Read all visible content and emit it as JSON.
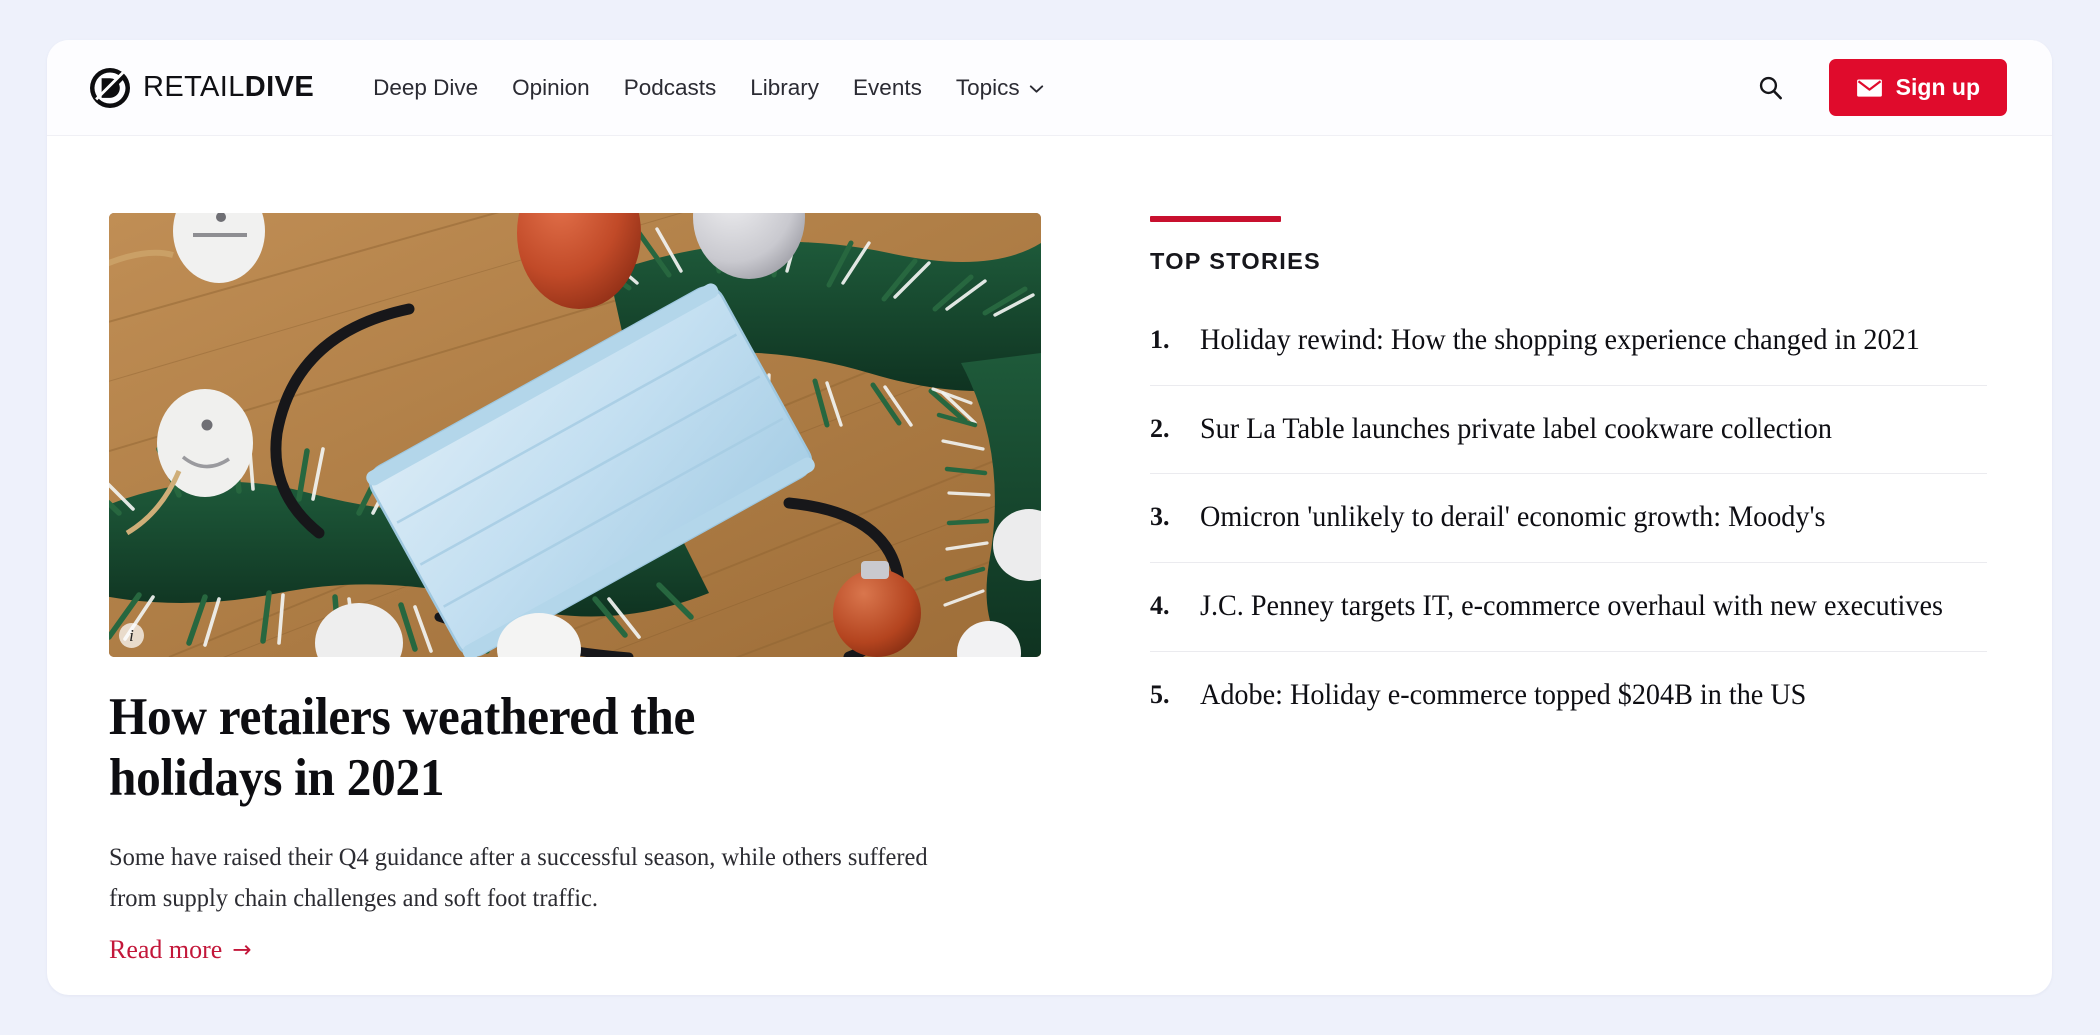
{
  "theme": {
    "page_background": "#eef1fb",
    "card_background": "#ffffff",
    "brand_red": "#e00b2c",
    "accent_red": "#c8102e",
    "link_red": "#c3173a",
    "text_dark": "#0e0e13"
  },
  "header": {
    "brand_mark_icon": "retail-dive-logo-icon",
    "brand_name_light": "RETAIL",
    "brand_name_bold": "DIVE",
    "nav": [
      {
        "label": "Deep Dive",
        "has_dropdown": false
      },
      {
        "label": "Opinion",
        "has_dropdown": false
      },
      {
        "label": "Podcasts",
        "has_dropdown": false
      },
      {
        "label": "Library",
        "has_dropdown": false
      },
      {
        "label": "Events",
        "has_dropdown": false
      },
      {
        "label": "Topics",
        "has_dropdown": true
      }
    ],
    "search_icon": "search-icon",
    "signup": {
      "label": "Sign up",
      "icon": "envelope-icon"
    }
  },
  "feature": {
    "image_alt": "Blue surgical face mask resting on a wooden table surrounded by green holiday garland and red and silver ornaments",
    "image_credit_icon": "info-icon",
    "title": "How retailers weathered the holidays in 2021",
    "dek": "Some have raised their Q4 guidance after a successful season, while others suffered from supply chain challenges and soft foot traffic.",
    "read_more_label": "Read more",
    "read_more_arrow": "→"
  },
  "top_stories": {
    "heading": "TOP STORIES",
    "items": [
      {
        "rank": "1.",
        "title": "Holiday rewind: How the shopping experience changed in 2021"
      },
      {
        "rank": "2.",
        "title": "Sur La Table launches private label cookware collection"
      },
      {
        "rank": "3.",
        "title": "Omicron 'unlikely to derail' economic growth: Moody's"
      },
      {
        "rank": "4.",
        "title": "J.C. Penney targets IT, e-commerce overhaul with new executives"
      },
      {
        "rank": "5.",
        "title": "Adobe: Holiday e-commerce topped $204B in the US"
      }
    ]
  }
}
